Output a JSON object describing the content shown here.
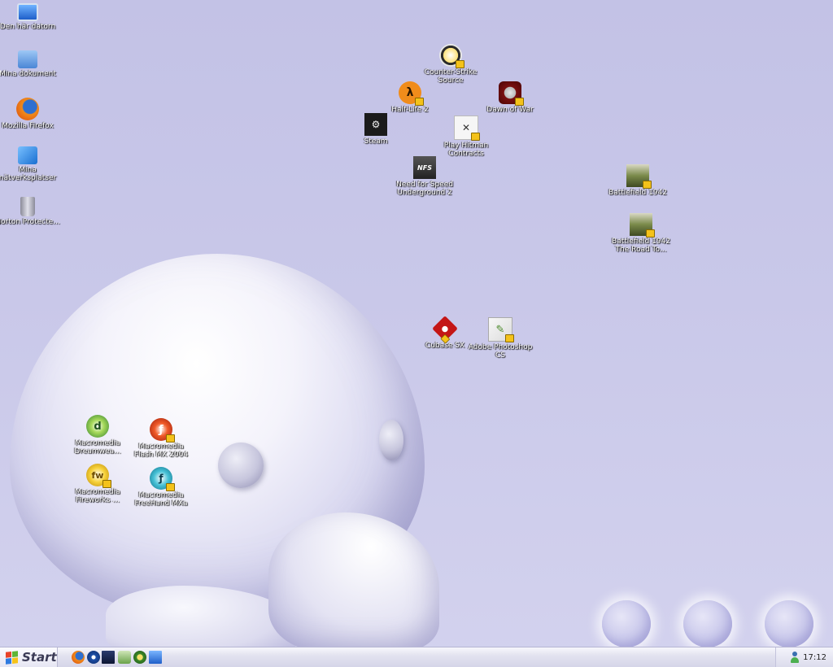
{
  "desktop": {
    "icons": [
      {
        "id": "computer",
        "label": "Den här datorn",
        "icon": "computer-icon"
      },
      {
        "id": "documents",
        "label": "Mina dokument",
        "icon": "documents-folder-icon"
      },
      {
        "id": "firefox",
        "label": "Mozilla Firefox",
        "icon": "firefox-icon"
      },
      {
        "id": "network",
        "label": "Mina nätverksplatser",
        "icon": "network-places-icon"
      },
      {
        "id": "norton",
        "label": "Norton Protecte...",
        "icon": "recycle-bin-icon"
      },
      {
        "id": "cs_source",
        "label": "Counter-Strike Source",
        "icon": "counter-strike-icon"
      },
      {
        "id": "hl2",
        "label": "Half-Life 2",
        "icon": "half-life-icon"
      },
      {
        "id": "dow",
        "label": "Dawn of War",
        "icon": "dawn-of-war-icon"
      },
      {
        "id": "steam",
        "label": "Steam",
        "icon": "steam-icon"
      },
      {
        "id": "hitman",
        "label": "Play Hitman Contracts",
        "icon": "hitman-icon"
      },
      {
        "id": "nfs",
        "label": "Need for Speed Underground 2",
        "icon": "nfs-icon"
      },
      {
        "id": "bf1942",
        "label": "Battlefield 1942",
        "icon": "battlefield-icon"
      },
      {
        "id": "bf1942rtr",
        "label": "Battlefield 1942 The Road To...",
        "icon": "battlefield-icon"
      },
      {
        "id": "cubase",
        "label": "Cubase SX",
        "icon": "cubase-icon"
      },
      {
        "id": "photoshop",
        "label": "Adobe Photoshop CS",
        "icon": "photoshop-icon"
      },
      {
        "id": "dreamweaver",
        "label": "Macromedia Dreamwea...",
        "icon": "dreamweaver-icon"
      },
      {
        "id": "flash",
        "label": "Macromedia Flash MX 2004",
        "icon": "flash-icon"
      },
      {
        "id": "fireworks",
        "label": "Macromedia Fireworks ...",
        "icon": "fireworks-icon"
      },
      {
        "id": "freehand",
        "label": "Macromedia FreeHand MXa",
        "icon": "freehand-icon"
      }
    ]
  },
  "taskbar": {
    "start_label": "Start",
    "quick_launch": [
      "firefox-icon",
      "media-player-icon",
      "winamp-icon",
      "music-icon",
      "messenger-icon",
      "show-desktop-icon"
    ],
    "tray_arrow": "‹",
    "clock": "17:12"
  },
  "colors": {
    "background": "#c5c4e7",
    "taskbar": "#e3e3f0",
    "label_text": "#ffffff"
  }
}
